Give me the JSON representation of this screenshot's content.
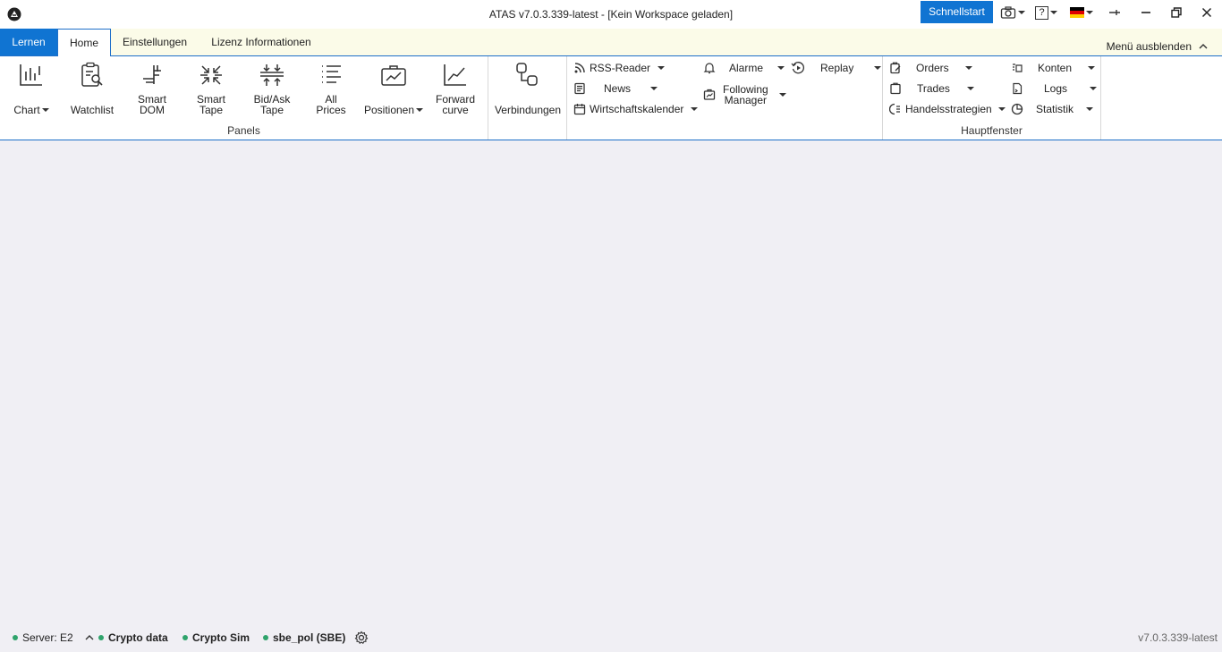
{
  "titlebar": {
    "title": "ATAS v7.0.3.339-latest - [Kein Workspace geladen]",
    "quickstart_label": "Schnellstart",
    "help_label": "?",
    "flag_colors": [
      "#000000",
      "#dd0000",
      "#ffce00"
    ]
  },
  "tabs": {
    "learn": "Lernen",
    "home": "Home",
    "settings": "Einstellungen",
    "license": "Lizenz Informationen",
    "hide_menu": "Menü ausblenden"
  },
  "ribbon": {
    "panels": {
      "group_label": "Panels",
      "chart": "Chart",
      "watchlist": "Watchlist",
      "smart_dom_1": "Smart",
      "smart_dom_2": "DOM",
      "smart_tape_1": "Smart",
      "smart_tape_2": "Tape",
      "bidask_1": "Bid/Ask",
      "bidask_2": "Tape",
      "allprices_1": "All",
      "allprices_2": "Prices",
      "positions": "Positionen",
      "forward_1": "Forward",
      "forward_2": "curve"
    },
    "connections": "Verbindungen",
    "tools": {
      "rss": "RSS-Reader",
      "news": "News",
      "calendar": "Wirtschaftskalender",
      "alarms": "Alarme",
      "following_1": "Following",
      "following_2": "Manager",
      "replay": "Replay"
    },
    "main_window": {
      "group_label": "Hauptfenster",
      "orders": "Orders",
      "trades": "Trades",
      "strategies": "Handelsstrategien",
      "accounts": "Konten",
      "logs": "Logs",
      "statistics": "Statistik"
    }
  },
  "statusbar": {
    "server": "Server: E2",
    "crypto_data": "Crypto data",
    "crypto_sim": "Crypto Sim",
    "sbe": "sbe_pol (SBE)",
    "version": "v7.0.3.339-latest",
    "status_color": "#2fa36b"
  },
  "colors": {
    "accent": "#1074d2",
    "tabstrip_bg": "#fbfbe8",
    "workspace_bg": "#f0eff4"
  }
}
